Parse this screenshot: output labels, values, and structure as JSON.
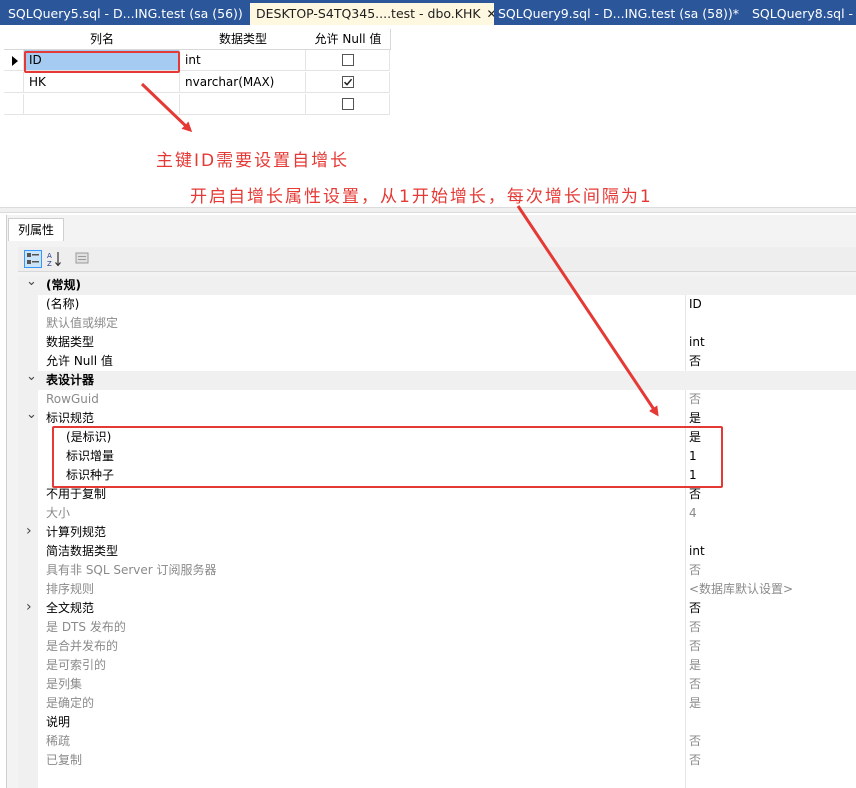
{
  "tabs": [
    {
      "label": "SQLQuery5.sql - D...ING.test (sa (56))",
      "active": false
    },
    {
      "label": "DESKTOP-S4TQ345....test - dbo.KHK",
      "active": true
    },
    {
      "label": "SQLQuery9.sql - D...ING.test (sa (58))*",
      "active": false
    },
    {
      "label": "SQLQuery8.sql - D",
      "active": false
    }
  ],
  "grid": {
    "headers": [
      "列名",
      "数据类型",
      "允许 Null 值"
    ],
    "rows": [
      {
        "name": "ID",
        "type": "int",
        "allow_null": false,
        "selected": true
      },
      {
        "name": "HK",
        "type": "nvarchar(MAX)",
        "allow_null": true,
        "selected": false
      },
      {
        "name": "",
        "type": "",
        "allow_null": false,
        "selected": false
      }
    ]
  },
  "annotations": {
    "primary_key": "主键ID需要设置自增长",
    "identity_hint": "开启自增长属性设置，从1开始增长，每次增长间隔为1",
    "color": "#e53935"
  },
  "properties": {
    "tab_label": "列属性",
    "toolbar": {
      "categorized_icon": "categorized-icon",
      "alphabetical_icon": "sort-az-icon",
      "pages_icon": "property-pages-icon"
    },
    "rows": [
      {
        "name": "(常规)",
        "value": "",
        "kind": "cat",
        "expand": "open"
      },
      {
        "name": "(名称)",
        "value": "ID",
        "kind": "item"
      },
      {
        "name": "默认值或绑定",
        "value": "",
        "kind": "item",
        "gray": true
      },
      {
        "name": "数据类型",
        "value": "int",
        "kind": "item"
      },
      {
        "name": "允许 Null 值",
        "value": "否",
        "kind": "item"
      },
      {
        "name": "表设计器",
        "value": "",
        "kind": "cat",
        "expand": "open"
      },
      {
        "name": "RowGuid",
        "value": "否",
        "kind": "item",
        "gray": true
      },
      {
        "name": "标识规范",
        "value": "是",
        "kind": "item",
        "expand": "open"
      },
      {
        "name": "(是标识)",
        "value": "是",
        "kind": "sub"
      },
      {
        "name": "标识增量",
        "value": "1",
        "kind": "sub"
      },
      {
        "name": "标识种子",
        "value": "1",
        "kind": "sub"
      },
      {
        "name": "不用于复制",
        "value": "否",
        "kind": "item"
      },
      {
        "name": "大小",
        "value": "4",
        "kind": "item",
        "gray": true
      },
      {
        "name": "计算列规范",
        "value": "",
        "kind": "item",
        "expand": "closed"
      },
      {
        "name": "简洁数据类型",
        "value": "int",
        "kind": "item"
      },
      {
        "name": "具有非 SQL Server 订阅服务器",
        "value": "否",
        "kind": "item",
        "gray": true
      },
      {
        "name": "排序规则",
        "value": "<数据库默认设置>",
        "kind": "item",
        "gray": true
      },
      {
        "name": "全文规范",
        "value": "否",
        "kind": "item",
        "expand": "closed"
      },
      {
        "name": "是 DTS 发布的",
        "value": "否",
        "kind": "item",
        "gray": true
      },
      {
        "name": "是合并发布的",
        "value": "否",
        "kind": "item",
        "gray": true
      },
      {
        "name": "是可索引的",
        "value": "是",
        "kind": "item",
        "gray": true
      },
      {
        "name": "是列集",
        "value": "否",
        "kind": "item",
        "gray": true
      },
      {
        "name": "是确定的",
        "value": "是",
        "kind": "item",
        "gray": true
      },
      {
        "name": "说明",
        "value": "",
        "kind": "item"
      },
      {
        "name": "稀疏",
        "value": "否",
        "kind": "item",
        "gray": true
      },
      {
        "name": "已复制",
        "value": "否",
        "kind": "item",
        "gray": true
      }
    ]
  }
}
